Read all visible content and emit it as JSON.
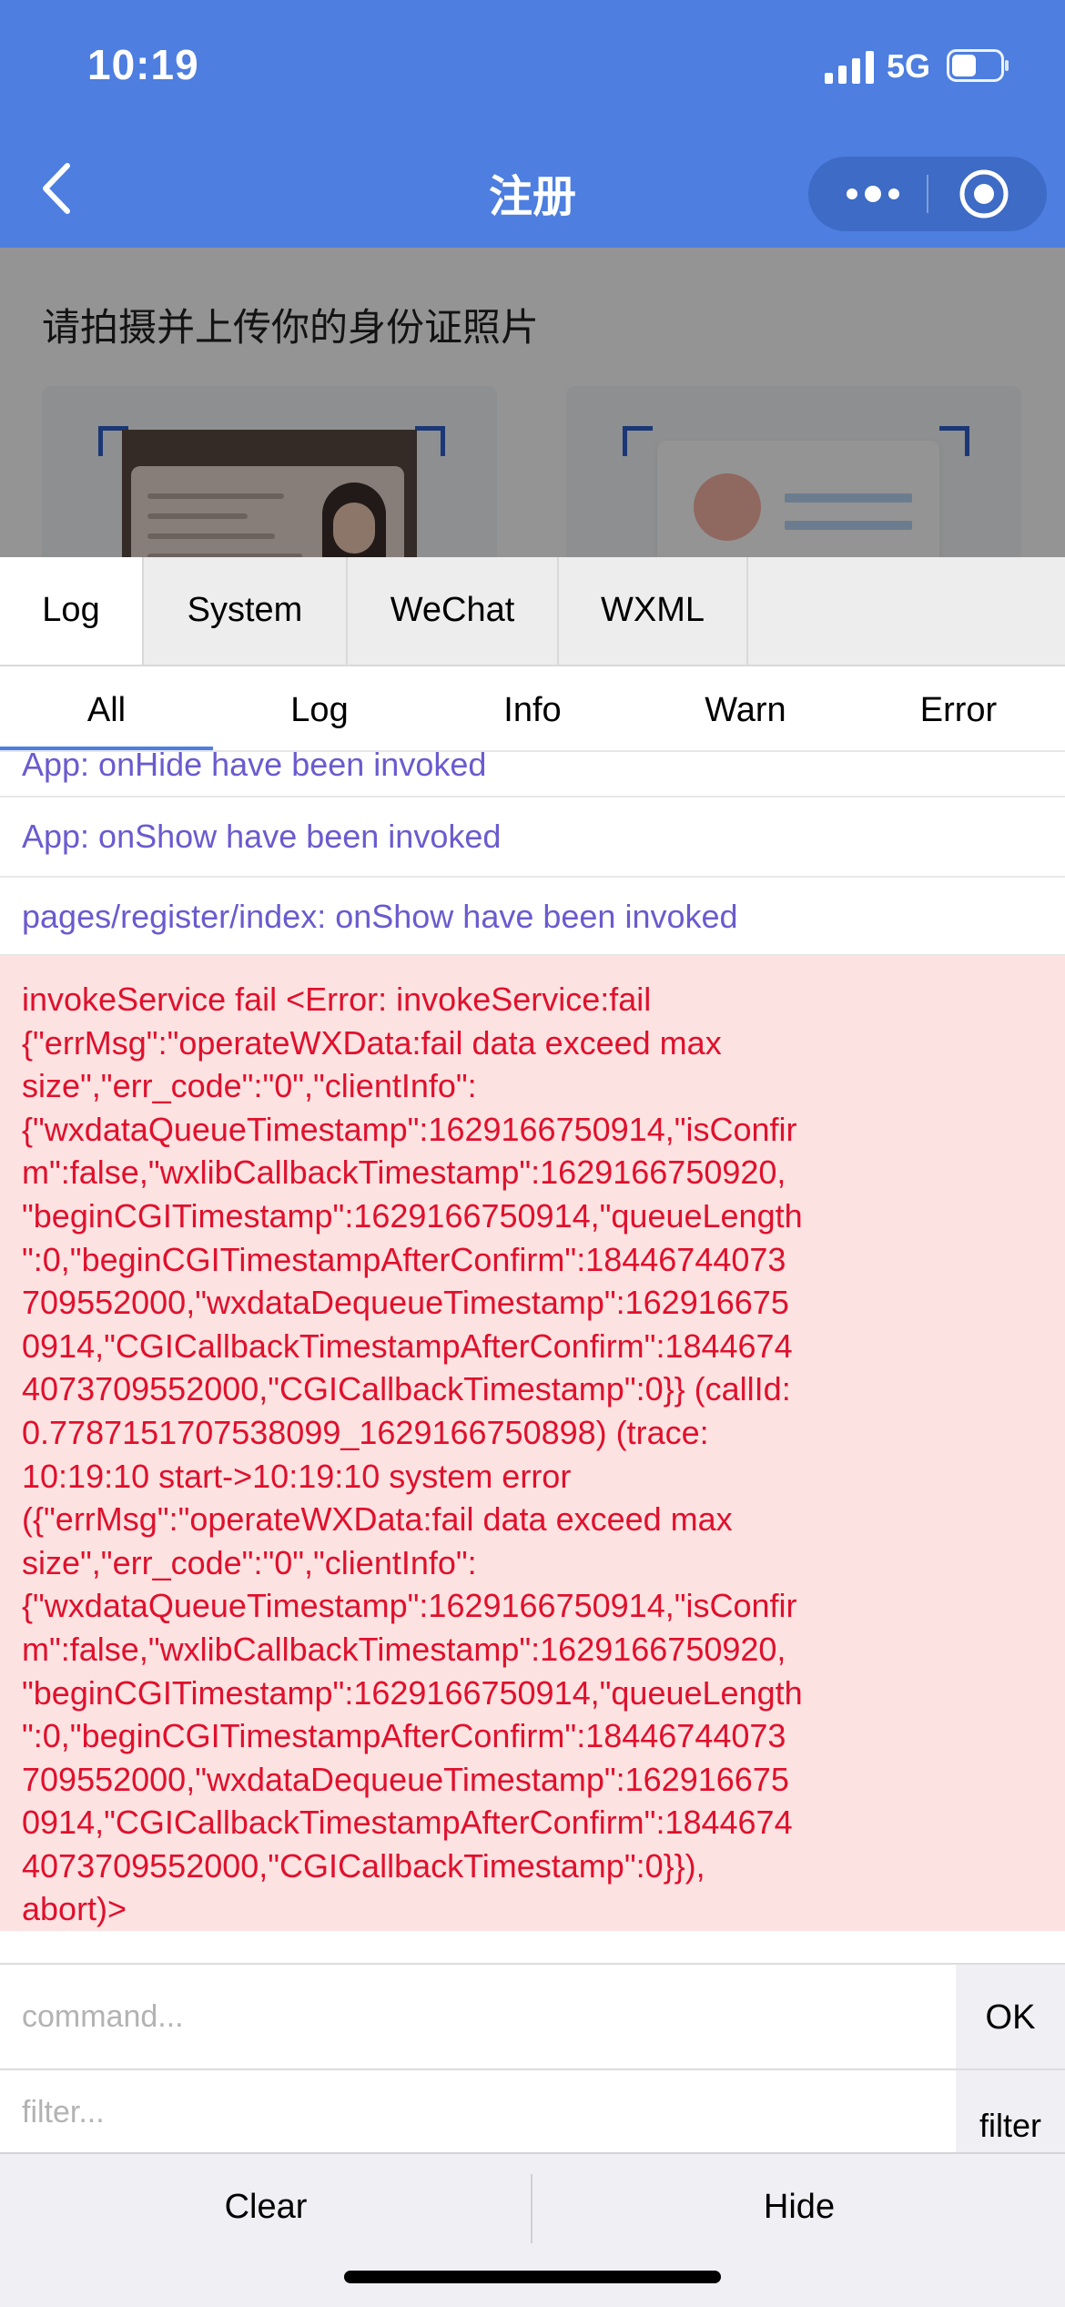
{
  "status_bar": {
    "time": "10:19",
    "network": "5G"
  },
  "nav": {
    "title": "注册"
  },
  "page": {
    "heading": "请拍摄并上传你的身份证照片"
  },
  "console": {
    "tabs": [
      "Log",
      "System",
      "WeChat",
      "WXML"
    ],
    "active_tab": "Log",
    "subtabs": [
      "All",
      "Log",
      "Info",
      "Warn",
      "Error"
    ],
    "active_subtab": "All",
    "log_entries": [
      "App: onHide have been invoked",
      "App: onShow have been invoked",
      "pages/register/index: onShow have been invoked"
    ],
    "error_lines": [
      "invokeService fail <Error: invokeService:fail",
      "{\"errMsg\":\"operateWXData:fail data exceed max",
      "size\",\"err_code\":\"0\",\"clientInfo\":",
      "{\"wxdataQueueTimestamp\":1629166750914,\"isConfir",
      "m\":false,\"wxlibCallbackTimestamp\":1629166750920,",
      "\"beginCGITimestamp\":1629166750914,\"queueLength",
      "\":0,\"beginCGITimestampAfterConfirm\":18446744073",
      "709552000,\"wxdataDequeueTimestamp\":162916675",
      "0914,\"CGICallbackTimestampAfterConfirm\":1844674",
      "4073709552000,\"CGICallbackTimestamp\":0}} (callId:",
      "0.7787151707538099_1629166750898) (trace:",
      "10:19:10 start->10:19:10 system error",
      "({\"errMsg\":\"operateWXData:fail data exceed max",
      "size\",\"err_code\":\"0\",\"clientInfo\":",
      "{\"wxdataQueueTimestamp\":1629166750914,\"isConfir",
      "m\":false,\"wxlibCallbackTimestamp\":1629166750920,",
      "\"beginCGITimestamp\":1629166750914,\"queueLength",
      "\":0,\"beginCGITimestampAfterConfirm\":18446744073",
      "709552000,\"wxdataDequeueTimestamp\":162916675",
      "0914,\"CGICallbackTimestampAfterConfirm\":1844674",
      "4073709552000,\"CGICallbackTimestamp\":0}}),",
      "abort)>"
    ],
    "command_placeholder": "command...",
    "command_button": "OK",
    "filter_placeholder": "filter...",
    "filter_button": "filter",
    "clear_button": "Clear",
    "hide_button": "Hide"
  },
  "colors": {
    "nav_blue": "#4d7ee0",
    "log_purple": "#6a5bcf",
    "error_text": "#e0102c",
    "error_bg": "#fde2e2"
  },
  "icons": [
    "signal-icon",
    "battery-icon",
    "back-arrow-icon",
    "more-icon",
    "target-icon"
  ]
}
